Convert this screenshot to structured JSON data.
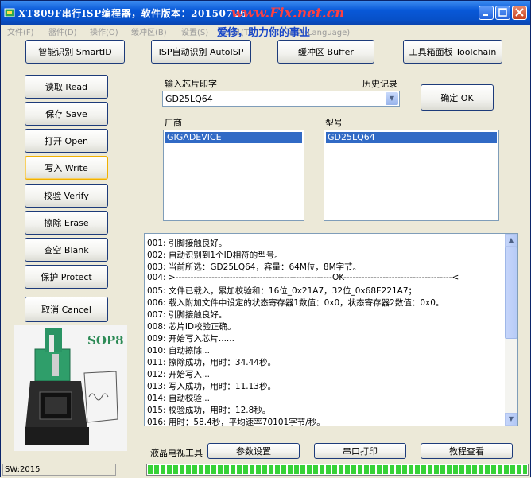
{
  "window": {
    "title": "XT809F串行ISP编程器，软件版本：20150726",
    "watermark": "www.Fix.net.cn",
    "watermark2": "爱修，助力你的事业"
  },
  "menu": [
    "文件(F)",
    "器件(D)",
    "操作(O)",
    "缓冲区(B)",
    "设置(S)",
    "工具(T)",
    "语言(Language)"
  ],
  "toolbar": {
    "smartid": "智能识别 SmartID",
    "autoisp": "ISP自动识别 AutoISP",
    "buffer": "缓冲区 Buffer",
    "toolchain": "工具箱面板 Toolchain"
  },
  "side_buttons": [
    "读取 Read",
    "保存 Save",
    "打开 Open",
    "写入 Write",
    "校验 Verify",
    "擦除 Erase",
    "查空 Blank",
    "保护 Protect",
    "取消 Cancel"
  ],
  "chip": {
    "input_label": "输入芯片印字",
    "history_label": "历史记录",
    "input_value": "GD25LQ64",
    "ok_button": "确定 OK",
    "vendor_label": "厂商",
    "model_label": "型号",
    "vendor_selected": "GIGADEVICE",
    "model_selected": "GD25LQ64"
  },
  "log": [
    "001: 引脚接触良好。",
    "002: 自动识别到1个ID相符的型号。",
    "003: 当前所选：GD25LQ64，容量：64M位，8M字节。",
    "004: >----------------------------------------------------OK------------------------------------<",
    "005: 文件已载入，累加校验和：16位_0x21A7，32位_0x68E221A7；",
    "006: 载入附加文件中设定的状态寄存器1数值：0x0，状态寄存器2数值：0x0。",
    "007: 引脚接触良好。",
    "008: 芯片ID校验正确。",
    "009: 开始写入芯片......",
    "010: 自动擦除...",
    "011: 擦除成功，用时：34.44秒。",
    "012: 开始写入...",
    "013: 写入成功，用时：11.13秒。",
    "014: 自动校验...",
    "015: 校验成功，用时：12.8秒。",
    "016: 用时：58.4秒，平均速率70101字节/秒。"
  ],
  "bottom": {
    "lcd_tool": "液晶电视工具",
    "params": "参数设置",
    "serial_print": "串口打印",
    "tutorial": "教程查看"
  },
  "photo": {
    "label": "SOP8"
  },
  "status": {
    "field": "SW:2015",
    "progress": 1.0
  },
  "colors": {
    "title_bar": "#0858d8",
    "selection": "#316ac5",
    "progress": "#37d237"
  }
}
